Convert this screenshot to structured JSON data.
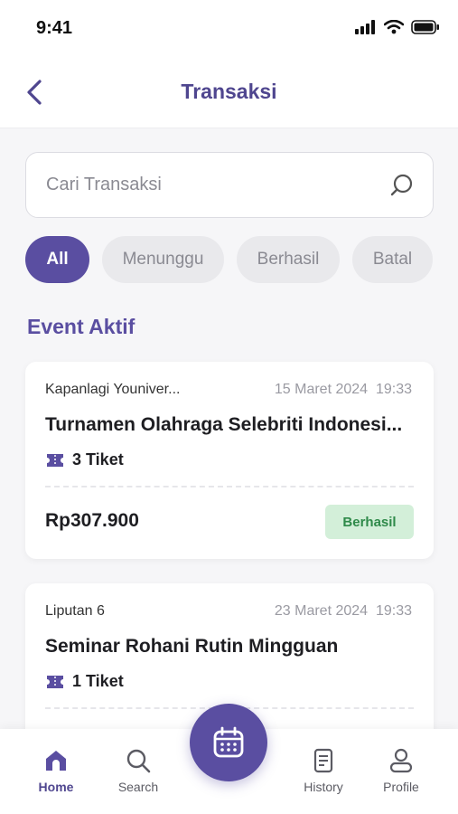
{
  "status": {
    "time": "9:41"
  },
  "header": {
    "title": "Transaksi"
  },
  "search": {
    "placeholder": "Cari Transaksi"
  },
  "filters": [
    {
      "label": "All",
      "active": true
    },
    {
      "label": "Menunggu",
      "active": false
    },
    {
      "label": "Berhasil",
      "active": false
    },
    {
      "label": "Batal",
      "active": false
    }
  ],
  "section": {
    "title": "Event Aktif"
  },
  "transactions": [
    {
      "organizer": "Kapanlagi Youniver...",
      "date": "15 Maret 2024",
      "time": "19:33",
      "title": "Turnamen Olahraga Selebriti Indonesi...",
      "tickets": "3 Tiket",
      "price": "Rp307.900",
      "status": "Berhasil"
    },
    {
      "organizer": "Liputan 6",
      "date": "23 Maret 2024",
      "time": "19:33",
      "title": "Seminar Rohani Rutin Mingguan",
      "tickets": "1 Tiket"
    }
  ],
  "nav": {
    "home": "Home",
    "search": "Search",
    "history": "History",
    "profile": "Profile"
  },
  "colors": {
    "primary": "#5a4ea1",
    "success_bg": "#d3efd9",
    "success_text": "#2f8a4a"
  }
}
